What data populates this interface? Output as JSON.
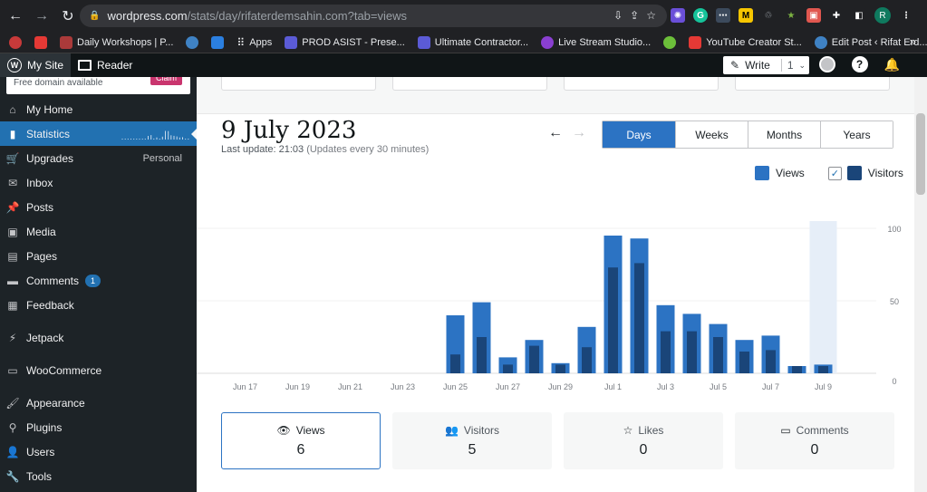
{
  "browser": {
    "url_host": "wordpress.com",
    "url_path": "/stats/day/rifaterdemsahin.com?tab=views",
    "profile_initial": "R",
    "bookmarks": [
      {
        "label": "",
        "color": "#c83a3a"
      },
      {
        "label": "",
        "color": "#e53935"
      },
      {
        "label": "Daily Workshops | P...",
        "color": "#aa3a3a"
      },
      {
        "label": "",
        "color": "#3f82c4"
      },
      {
        "label": "",
        "color": "#2b7fe0"
      },
      {
        "label": "Apps",
        "color": ""
      },
      {
        "label": "PROD ASIST - Prese...",
        "color": "#5b5bd6"
      },
      {
        "label": "Ultimate Contractor...",
        "color": "#5b5bd6"
      },
      {
        "label": "Live Stream Studio...",
        "color": "#8a3fd1"
      },
      {
        "label": "",
        "color": "#6cbf3a"
      },
      {
        "label": "YouTube Creator St...",
        "color": "#e53935"
      },
      {
        "label": "Edit Post ‹ Rifat Erd...",
        "color": "#3f82c4"
      }
    ]
  },
  "adminbar": {
    "my_site": "My Site",
    "reader": "Reader",
    "write": "Write",
    "write_count": "1"
  },
  "sidebar": {
    "claim_text": "Free domain available",
    "claim_button": "Claim",
    "items": [
      {
        "label": "My Home",
        "icon": "house-icon",
        "glyph": "⌂"
      },
      {
        "label": "Statistics",
        "icon": "bar-chart-icon",
        "glyph": "▮",
        "current": true
      },
      {
        "label": "Upgrades",
        "icon": "cart-icon",
        "glyph": "🛒",
        "extra": "Personal"
      },
      {
        "label": "Inbox",
        "icon": "mail-icon",
        "glyph": "✉"
      },
      {
        "label": "Posts",
        "icon": "pin-icon",
        "glyph": "📌"
      },
      {
        "label": "Media",
        "icon": "media-icon",
        "glyph": "▣"
      },
      {
        "label": "Pages",
        "icon": "page-icon",
        "glyph": "▤"
      },
      {
        "label": "Comments",
        "icon": "comment-icon",
        "glyph": "▬",
        "badge": "1"
      },
      {
        "label": "Feedback",
        "icon": "feedback-icon",
        "glyph": "▦"
      },
      {
        "label": "Jetpack",
        "icon": "jetpack-icon",
        "glyph": "⚡",
        "gap": true
      },
      {
        "label": "WooCommerce",
        "icon": "woocommerce-icon",
        "glyph": "▭",
        "gap": true
      },
      {
        "label": "Appearance",
        "icon": "brush-icon",
        "glyph": "🖌",
        "gap": true
      },
      {
        "label": "Plugins",
        "icon": "plug-icon",
        "glyph": "⚲"
      },
      {
        "label": "Users",
        "icon": "user-icon",
        "glyph": "👤"
      },
      {
        "label": "Tools",
        "icon": "wrench-icon",
        "glyph": "🔧"
      }
    ]
  },
  "stats": {
    "date_title": "9 July 2023",
    "last_update": "Last update: 21:03",
    "update_note": "(Updates every 30 minutes)",
    "period_tabs": [
      "Days",
      "Weeks",
      "Months",
      "Years"
    ],
    "active_period": "Days",
    "legend_views": "Views",
    "legend_visitors": "Visitors",
    "summary": [
      {
        "label": "Views",
        "value": "6",
        "icon": "eye-icon",
        "glyph": "👁",
        "active": true
      },
      {
        "label": "Visitors",
        "value": "5",
        "icon": "people-icon",
        "glyph": "👥"
      },
      {
        "label": "Likes",
        "value": "0",
        "icon": "star-icon",
        "glyph": "☆"
      },
      {
        "label": "Comments",
        "value": "0",
        "icon": "comment-icon",
        "glyph": "▭"
      }
    ]
  },
  "colors": {
    "views": "#2c73c3",
    "visitors": "#1a4579",
    "highlight": "#e6eef8"
  },
  "chart_data": {
    "type": "bar",
    "categories": [
      "Jun 16",
      "Jun 17",
      "Jun 18",
      "Jun 19",
      "Jun 20",
      "Jun 21",
      "Jun 22",
      "Jun 23",
      "Jun 24",
      "Jun 25",
      "Jun 26",
      "Jun 27",
      "Jun 28",
      "Jun 29",
      "Jun 30",
      "Jul 1",
      "Jul 2",
      "Jul 3",
      "Jul 4",
      "Jul 5",
      "Jul 6",
      "Jul 7",
      "Jul 8",
      "Jul 9"
    ],
    "tick_labels": [
      "Jun 17",
      "Jun 19",
      "Jun 21",
      "Jun 23",
      "Jun 25",
      "Jun 27",
      "Jun 29",
      "Jul 1",
      "Jul 3",
      "Jul 5",
      "Jul 7",
      "Jul 9"
    ],
    "series": [
      {
        "name": "Views",
        "values": [
          0,
          0,
          0,
          0,
          0,
          0,
          0,
          0,
          0,
          40,
          49,
          11,
          23,
          7,
          32,
          95,
          93,
          47,
          41,
          34,
          23,
          26,
          5,
          6
        ]
      },
      {
        "name": "Visitors",
        "values": [
          0,
          0,
          0,
          0,
          0,
          0,
          0,
          0,
          0,
          13,
          25,
          6,
          19,
          6,
          18,
          73,
          76,
          29,
          29,
          25,
          15,
          16,
          5,
          5
        ]
      }
    ],
    "yticks": [
      0,
      50,
      100
    ],
    "ylim": [
      0,
      100
    ],
    "highlight_category": "Jul 9"
  }
}
